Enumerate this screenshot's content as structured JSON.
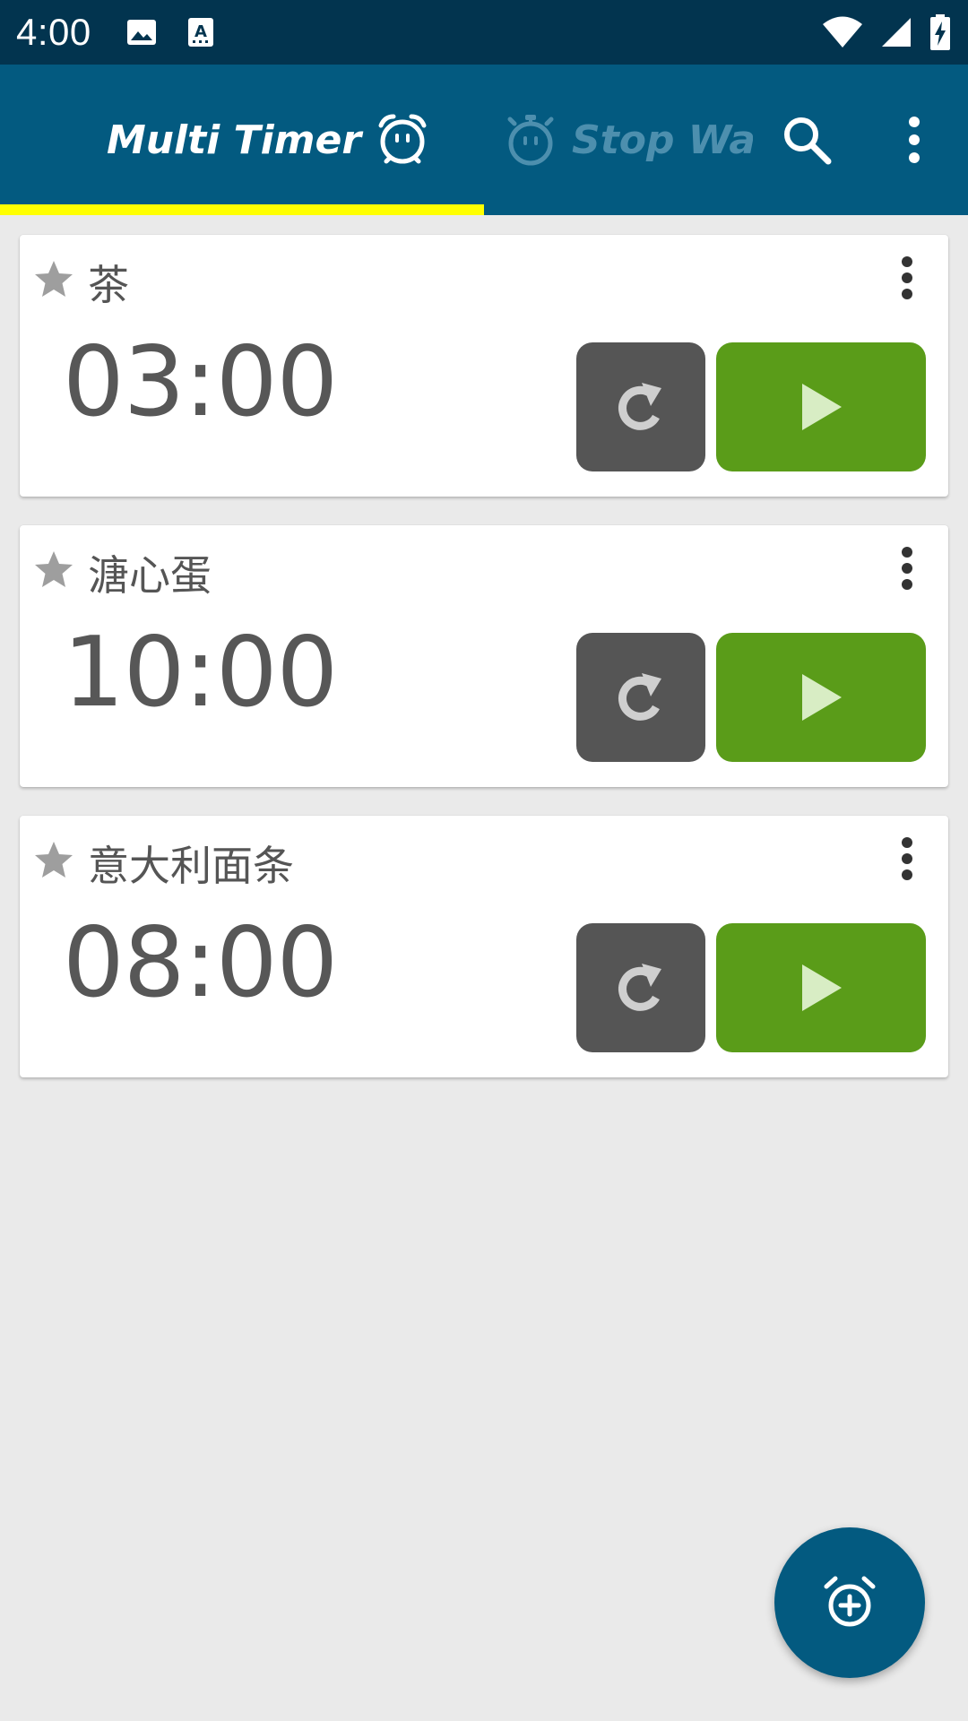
{
  "status_bar": {
    "time": "4:00",
    "left_icons": [
      "image-icon",
      "keyboard-a-icon"
    ],
    "right_icons": [
      "wifi-icon",
      "signal-icon",
      "battery-charging-icon"
    ]
  },
  "app_bar": {
    "tabs": [
      {
        "label": "Multi Timer",
        "icon": "alarm-clock-face-icon",
        "selected": true
      },
      {
        "label": "Stop Watc",
        "icon": "stopwatch-face-icon",
        "selected": false
      }
    ],
    "actions": [
      "search-icon",
      "more-vert-icon"
    ]
  },
  "timers": [
    {
      "name": "茶",
      "time": "03:00"
    },
    {
      "name": "溏心蛋",
      "time": "10:00"
    },
    {
      "name": "意大利面条",
      "time": "08:00"
    }
  ],
  "fab": {
    "icon": "add-alarm-icon"
  },
  "colors": {
    "status_bar": "#02344f",
    "app_bar": "#035a80",
    "tab_indicator": "#ffff00",
    "play_button": "#5a9c19",
    "reset_button": "#555555",
    "background": "#eaeaea"
  }
}
